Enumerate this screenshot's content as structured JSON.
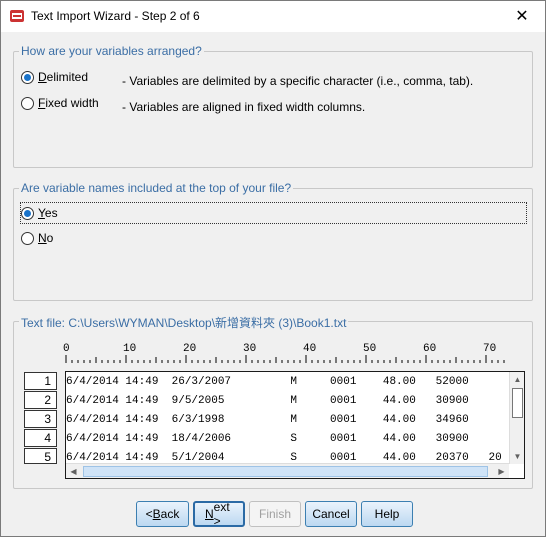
{
  "window": {
    "title": "Text Import Wizard - Step 2 of 6",
    "close_glyph": "✕"
  },
  "arrangement": {
    "legend": "How are your variables arranged?",
    "options": [
      {
        "label": "Delimited",
        "mnemonic": "D",
        "rest": "elimited",
        "description": "- Variables are delimited by a specific character (i.e., comma, tab).",
        "selected": true
      },
      {
        "label": "Fixed width",
        "mnemonic": "F",
        "rest": "ixed width",
        "description": "- Variables are aligned in fixed width columns.",
        "selected": false
      }
    ]
  },
  "names": {
    "legend": "Are variable names included at the top of your file?",
    "options": [
      {
        "label": "Yes",
        "mnemonic": "Y",
        "rest": "es",
        "selected": true
      },
      {
        "label": "No",
        "mnemonic": "N",
        "rest": "o",
        "selected": false
      }
    ]
  },
  "preview": {
    "legend": "Text file:  C:\\Users\\WYMAN\\Desktop\\新增資料夾 (3)\\Book1.txt",
    "ruler_marks": [
      "0",
      "10",
      "20",
      "30",
      "40",
      "50",
      "60",
      "70"
    ],
    "row_numbers": [
      "1",
      "2",
      "3",
      "4",
      "5"
    ],
    "rows": [
      "6/4/2014 14:49  26/3/2007         M     0001    48.00   52000",
      "6/4/2014 14:49  9/5/2005          M     0001    44.00   30900",
      "6/4/2014 14:49  6/3/1998          M     0001    44.00   34960",
      "6/4/2014 14:49  18/4/2006         S     0001    44.00   30900",
      "6/4/2014 14:49  5/1/2004          S     0001    44.00   20370   20"
    ],
    "scroll_up": "▲",
    "scroll_down": "▼",
    "scroll_left": "◀",
    "scroll_right": "▶"
  },
  "buttons": {
    "back": {
      "lead": "< ",
      "mnemonic": "B",
      "rest": "ack"
    },
    "next": {
      "mnemonic": "N",
      "rest": "ext >"
    },
    "finish": "Finish",
    "cancel": "Cancel",
    "help": "Help"
  },
  "colors": {
    "legend_text": "#3b6ea5",
    "radio_dot": "#1a73c9",
    "button_border": "#3c7fb1"
  }
}
